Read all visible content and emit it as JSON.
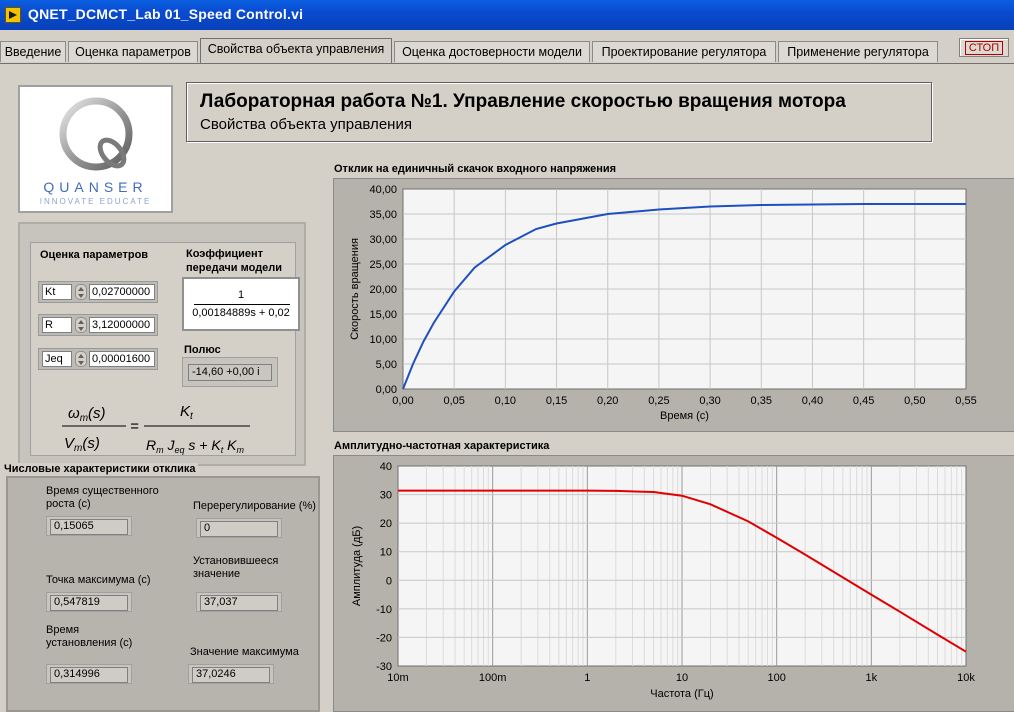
{
  "window": {
    "title": "QNET_DCMCT_Lab 01_Speed Control.vi"
  },
  "tabs": [
    {
      "label": "Введение"
    },
    {
      "label": "Оценка параметров"
    },
    {
      "label": "Свойства объекта управления"
    },
    {
      "label": "Оценка достоверности модели"
    },
    {
      "label": "Проектирование регулятора"
    },
    {
      "label": "Применение регулятора"
    }
  ],
  "active_tab": 2,
  "stop_button": {
    "label": "СТОП"
  },
  "logo": {
    "word": "QUANSER",
    "tagline": "INNOVATE  EDUCATE"
  },
  "header": {
    "title": "Лабораторная работа №1. Управление скоростью вращения мотора",
    "subtitle": "Свойства объекта управления"
  },
  "params": {
    "title": "Оценка параметров",
    "rows": [
      {
        "name": "Kt",
        "value": "0,02700000"
      },
      {
        "name": "R",
        "value": "3,12000000"
      },
      {
        "name": "Jeq",
        "value": "0,00001600"
      }
    ]
  },
  "transfer_function": {
    "title_line1": "Коэффициент",
    "title_line2": "передачи модели",
    "numerator": "1",
    "denominator": "0,00184889s + 0,02"
  },
  "pole": {
    "title": "Полюс",
    "value": "-14,60 +0,00 i"
  },
  "response": {
    "title": "Числовые характеристики отклика",
    "rise_time": {
      "label_line1": "Время существенного",
      "label_line2": "роста (с)",
      "value": "0,15065"
    },
    "overshoot": {
      "label": "Перерегулирование (%)",
      "value": "0"
    },
    "peak_time": {
      "label": "Точка максимума (с)",
      "value": "0,547819"
    },
    "steady_state": {
      "label_line1": "Установившееся",
      "label_line2": "значение",
      "value": "37,037"
    },
    "settling_time": {
      "label_line1": "Время",
      "label_line2": "установления (с)",
      "value": "0,314996"
    },
    "peak_value": {
      "label": "Значение максимума",
      "value": "37,0246"
    }
  },
  "colors": {
    "step_line": "#1f4fbf",
    "bode_line": "#e00000",
    "plot_bg": "#f5f5f5",
    "grid": "#c8c8c8"
  },
  "chart_data": [
    {
      "type": "line",
      "title": "Отклик на единичный скачок входного напряжения",
      "xlabel": "Время (с)",
      "ylabel": "Скорость вращения",
      "xlim": [
        0,
        0.55
      ],
      "ylim": [
        0,
        40
      ],
      "x_ticks": [
        "0,00",
        "0,05",
        "0,10",
        "0,15",
        "0,20",
        "0,25",
        "0,30",
        "0,35",
        "0,40",
        "0,45",
        "0,50",
        "0,55"
      ],
      "y_ticks": [
        "0,00",
        "5,00",
        "10,00",
        "15,00",
        "20,00",
        "25,00",
        "30,00",
        "35,00",
        "40,00"
      ],
      "series": [
        {
          "x": [
            0,
            0.01,
            0.02,
            0.03,
            0.05,
            0.07,
            0.1,
            0.13,
            0.15,
            0.2,
            0.25,
            0.3,
            0.35,
            0.4,
            0.45,
            0.5,
            0.55
          ],
          "y": [
            0,
            5.1,
            9.5,
            13.2,
            19.5,
            24.3,
            28.8,
            32.0,
            33.1,
            35.0,
            35.9,
            36.5,
            36.8,
            36.9,
            37.0,
            37.0,
            37.0
          ]
        }
      ],
      "grid": true
    },
    {
      "type": "line",
      "title": "Амплитудно-частотная характеристика",
      "xlabel": "Частота (Гц)",
      "ylabel": "Амплитуда (дБ)",
      "x_scale": "log",
      "xlim": [
        0.01,
        10000
      ],
      "ylim": [
        -30,
        40
      ],
      "x_ticks": [
        "10m",
        "100m",
        "1",
        "10",
        "100",
        "1k",
        "10k"
      ],
      "y_ticks": [
        "-30",
        "-20",
        "-10",
        "0",
        "10",
        "20",
        "30",
        "40"
      ],
      "series": [
        {
          "x": [
            0.01,
            0.1,
            1,
            2,
            5,
            10,
            20,
            50,
            100,
            200,
            500,
            1000,
            2000,
            5000,
            10000
          ],
          "y": [
            31.4,
            31.4,
            31.4,
            31.3,
            30.9,
            29.6,
            26.6,
            20.6,
            14.9,
            9.0,
            1.0,
            -5.0,
            -11.0,
            -19.0,
            -25.0
          ]
        }
      ],
      "grid": true
    }
  ]
}
